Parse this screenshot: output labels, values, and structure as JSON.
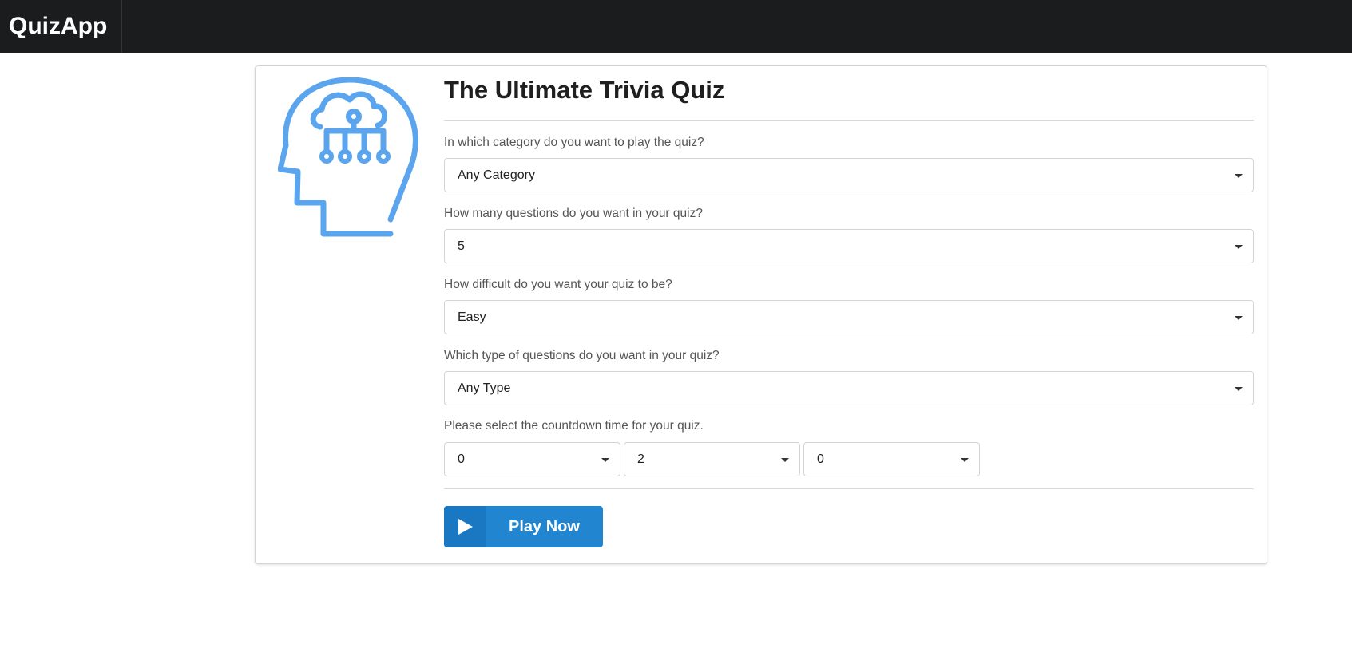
{
  "app": {
    "brand": "QuizApp"
  },
  "quiz": {
    "title": "The Ultimate Trivia Quiz",
    "category": {
      "label": "In which category do you want to play the quiz?",
      "value": "Any Category"
    },
    "amount": {
      "label": "How many questions do you want in your quiz?",
      "value": "5"
    },
    "difficulty": {
      "label": "How difficult do you want your quiz to be?",
      "value": "Easy"
    },
    "type": {
      "label": "Which type of questions do you want in your quiz?",
      "value": "Any Type"
    },
    "countdown": {
      "label": "Please select the countdown time for your quiz.",
      "hours": "0",
      "minutes": "2",
      "seconds": "0"
    },
    "play_button": "Play Now"
  },
  "icons": {
    "hero": "brain-head-icon",
    "play": "play-icon",
    "dropdown": "caret-down-icon"
  },
  "colors": {
    "navbar": "#1b1c1d",
    "accent": "#2185d0",
    "icon": "#5aa5ee"
  }
}
